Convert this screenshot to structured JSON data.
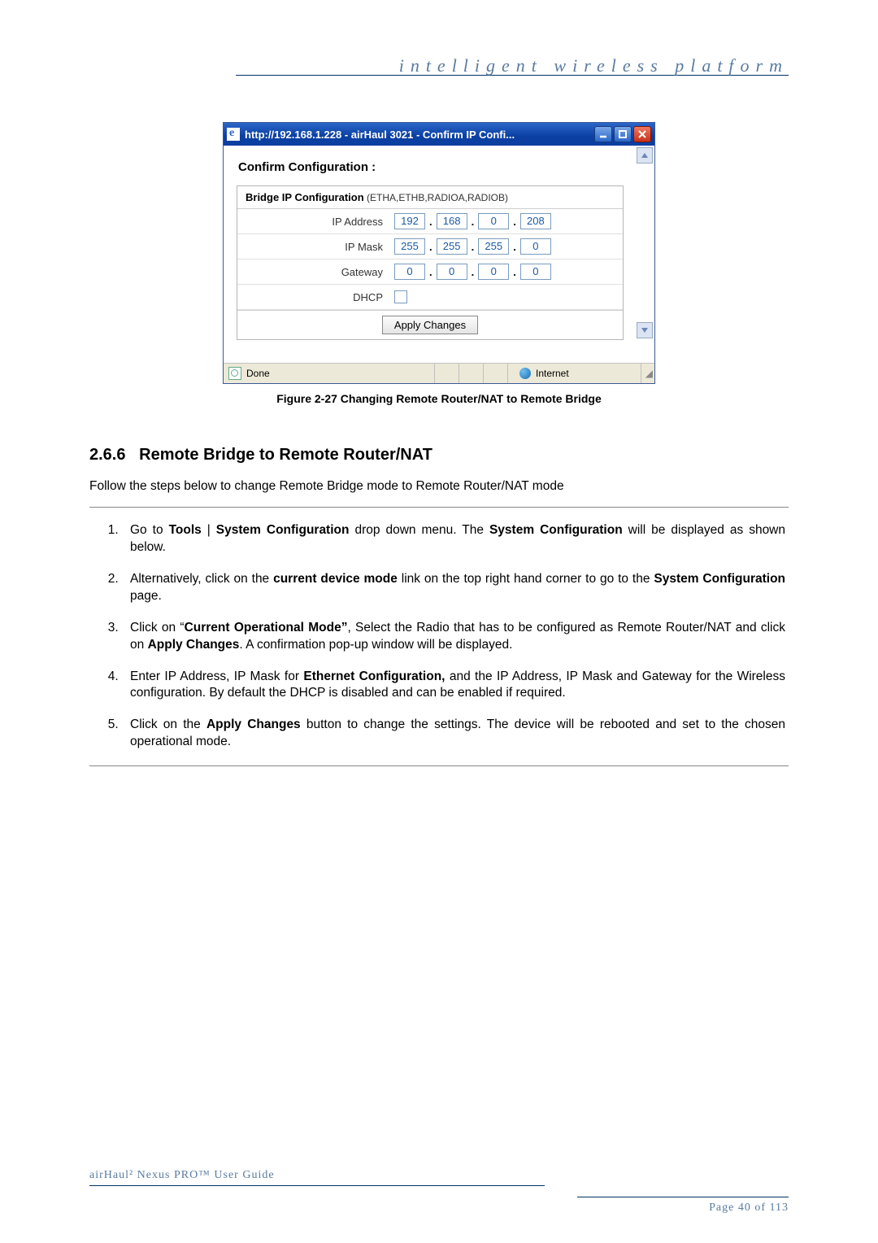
{
  "header": {
    "tagline": "intelligent  wireless  platform"
  },
  "dialog": {
    "title": "http://192.168.1.228 - airHaul 3021 - Confirm IP Confi...",
    "confirm_heading": "Confirm Configuration :",
    "bridge_heading_bold": "Bridge IP Configuration",
    "bridge_heading_sub": " (ETHA,ETHB,RADIOA,RADIOB)",
    "rows": {
      "ip_address": {
        "label": "IP Address",
        "o1": "192",
        "o2": "168",
        "o3": "0",
        "o4": "208"
      },
      "ip_mask": {
        "label": "IP Mask",
        "o1": "255",
        "o2": "255",
        "o3": "255",
        "o4": "0"
      },
      "gateway": {
        "label": "Gateway",
        "o1": "0",
        "o2": "0",
        "o3": "0",
        "o4": "0"
      },
      "dhcp": {
        "label": "DHCP"
      }
    },
    "apply_label": "Apply Changes",
    "status_done": "Done",
    "status_net": "Internet"
  },
  "figure_caption": "Figure 2-27 Changing Remote Router/NAT to Remote Bridge",
  "section": {
    "number": "2.6.6",
    "title": "Remote Bridge to Remote Router/NAT",
    "intro": "Follow the steps below to change Remote Bridge mode to Remote Router/NAT mode",
    "steps": {
      "s1a": "Go to ",
      "s1b": "Tools",
      "s1c": " | ",
      "s1d": "System Configuration",
      "s1e": " drop down menu. The ",
      "s1f": "System Configuration",
      "s1g": " will be displayed as shown below.",
      "s2a": "Alternatively, click on the ",
      "s2b": "current device mode",
      "s2c": " link on the top right hand corner to go to the ",
      "s2d": "System Configuration",
      "s2e": " page.",
      "s3a": "Click on “",
      "s3b": "Current Operational Mode”",
      "s3c": ", Select the Radio that has to be configured as Remote Router/NAT and click on ",
      "s3d": "Apply Changes",
      "s3e": ".   A confirmation pop-up window will be displayed.",
      "s4a": "Enter IP Address, IP Mask for ",
      "s4b": "Ethernet Configuration,",
      "s4c": " and the IP Address, IP Mask and Gateway for the Wireless configuration. By default the DHCP is disabled and can be enabled if required.",
      "s5a": "Click on the ",
      "s5b": "Apply Changes",
      "s5c": " button to change the settings. The device will be rebooted and set to the chosen operational mode."
    }
  },
  "footer": {
    "product": "airHaul² Nexus PRO™ User Guide",
    "page": "Page 40 of 113"
  }
}
